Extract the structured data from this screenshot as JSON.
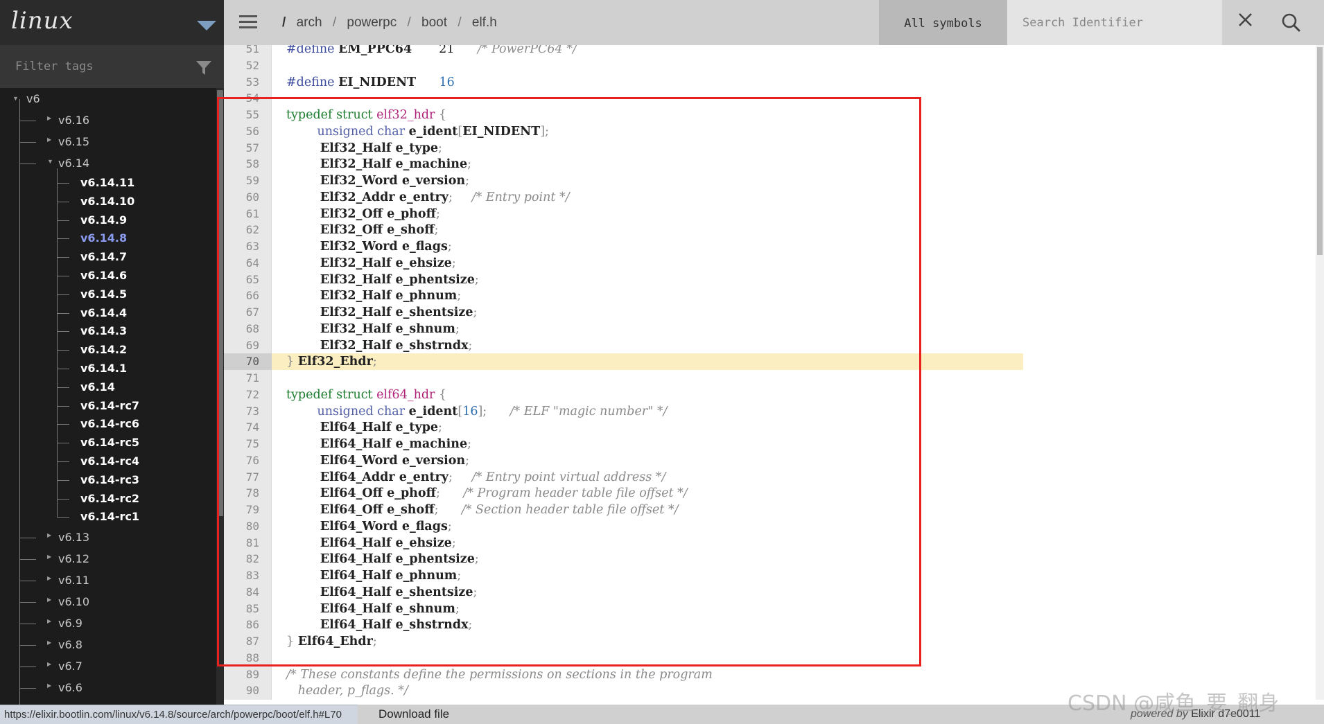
{
  "sidebar": {
    "project": "linux",
    "filter_placeholder": "Filter tags",
    "tree": [
      {
        "label": "v6",
        "kind": "root"
      },
      {
        "label": "v6.16",
        "kind": "ver"
      },
      {
        "label": "v6.15",
        "kind": "ver"
      },
      {
        "label": "v6.14",
        "kind": "ver-open"
      },
      {
        "label": "v6.14.11",
        "kind": "rel"
      },
      {
        "label": "v6.14.10",
        "kind": "rel"
      },
      {
        "label": "v6.14.9",
        "kind": "rel"
      },
      {
        "label": "v6.14.8",
        "kind": "rel",
        "current": true
      },
      {
        "label": "v6.14.7",
        "kind": "rel"
      },
      {
        "label": "v6.14.6",
        "kind": "rel"
      },
      {
        "label": "v6.14.5",
        "kind": "rel"
      },
      {
        "label": "v6.14.4",
        "kind": "rel"
      },
      {
        "label": "v6.14.3",
        "kind": "rel"
      },
      {
        "label": "v6.14.2",
        "kind": "rel"
      },
      {
        "label": "v6.14.1",
        "kind": "rel"
      },
      {
        "label": "v6.14",
        "kind": "rel"
      },
      {
        "label": "v6.14-rc7",
        "kind": "rel"
      },
      {
        "label": "v6.14-rc6",
        "kind": "rel"
      },
      {
        "label": "v6.14-rc5",
        "kind": "rel"
      },
      {
        "label": "v6.14-rc4",
        "kind": "rel"
      },
      {
        "label": "v6.14-rc3",
        "kind": "rel"
      },
      {
        "label": "v6.14-rc2",
        "kind": "rel"
      },
      {
        "label": "v6.14-rc1",
        "kind": "rel"
      },
      {
        "label": "v6.13",
        "kind": "ver"
      },
      {
        "label": "v6.12",
        "kind": "ver"
      },
      {
        "label": "v6.11",
        "kind": "ver"
      },
      {
        "label": "v6.10",
        "kind": "ver"
      },
      {
        "label": "v6.9",
        "kind": "ver"
      },
      {
        "label": "v6.8",
        "kind": "ver"
      },
      {
        "label": "v6.7",
        "kind": "ver"
      },
      {
        "label": "v6.6",
        "kind": "ver"
      }
    ]
  },
  "topbar": {
    "breadcrumb": [
      "arch",
      "powerpc",
      "boot",
      "elf.h"
    ],
    "root_sep": "/",
    "sep": "/",
    "symbols_label": "All symbols",
    "search_placeholder": "Search Identifier"
  },
  "code": {
    "highlight_line": 70,
    "lines": [
      {
        "n": 51,
        "t": [
          [
            "#define ",
            "mc"
          ],
          [
            "EM_PPC64",
            "bl"
          ],
          [
            "       21      ",
            ""
          ],
          [
            "/* PowerPC64 */",
            "cm"
          ]
        ]
      },
      {
        "n": 52,
        "t": []
      },
      {
        "n": 53,
        "t": [
          [
            "#define ",
            "mc"
          ],
          [
            "EI_NIDENT",
            "bl"
          ],
          [
            "      ",
            ""
          ],
          [
            "16",
            "nm"
          ]
        ]
      },
      {
        "n": 54,
        "t": []
      },
      {
        "n": 55,
        "t": [
          [
            "typedef ",
            "kw"
          ],
          [
            "struct ",
            "kw"
          ],
          [
            "elf32_hdr",
            "fn"
          ],
          [
            " {",
            "pu"
          ]
        ]
      },
      {
        "n": 56,
        "t": [
          [
            "        unsigned char ",
            "ty"
          ],
          [
            "e_ident",
            "bl"
          ],
          [
            "[",
            "pu"
          ],
          [
            "EI_NIDENT",
            "bl"
          ],
          [
            "];",
            "pu"
          ]
        ]
      },
      {
        "n": 57,
        "t": [
          [
            "        Elf32_Half ",
            "bl"
          ],
          [
            "e_type",
            "bl"
          ],
          [
            ";",
            "pu"
          ]
        ]
      },
      {
        "n": 58,
        "t": [
          [
            "        Elf32_Half ",
            "bl"
          ],
          [
            "e_machine",
            "bl"
          ],
          [
            ";",
            "pu"
          ]
        ]
      },
      {
        "n": 59,
        "t": [
          [
            "        Elf32_Word ",
            "bl"
          ],
          [
            "e_version",
            "bl"
          ],
          [
            ";",
            "pu"
          ]
        ]
      },
      {
        "n": 60,
        "t": [
          [
            "        Elf32_Addr ",
            "bl"
          ],
          [
            "e_entry",
            "bl"
          ],
          [
            ";     ",
            "pu"
          ],
          [
            "/* Entry point */",
            "cm"
          ]
        ]
      },
      {
        "n": 61,
        "t": [
          [
            "        Elf32_Off ",
            "bl"
          ],
          [
            "e_phoff",
            "bl"
          ],
          [
            ";",
            "pu"
          ]
        ]
      },
      {
        "n": 62,
        "t": [
          [
            "        Elf32_Off ",
            "bl"
          ],
          [
            "e_shoff",
            "bl"
          ],
          [
            ";",
            "pu"
          ]
        ]
      },
      {
        "n": 63,
        "t": [
          [
            "        Elf32_Word ",
            "bl"
          ],
          [
            "e_flags",
            "bl"
          ],
          [
            ";",
            "pu"
          ]
        ]
      },
      {
        "n": 64,
        "t": [
          [
            "        Elf32_Half ",
            "bl"
          ],
          [
            "e_ehsize",
            "bl"
          ],
          [
            ";",
            "pu"
          ]
        ]
      },
      {
        "n": 65,
        "t": [
          [
            "        Elf32_Half ",
            "bl"
          ],
          [
            "e_phentsize",
            "bl"
          ],
          [
            ";",
            "pu"
          ]
        ]
      },
      {
        "n": 66,
        "t": [
          [
            "        Elf32_Half ",
            "bl"
          ],
          [
            "e_phnum",
            "bl"
          ],
          [
            ";",
            "pu"
          ]
        ]
      },
      {
        "n": 67,
        "t": [
          [
            "        Elf32_Half ",
            "bl"
          ],
          [
            "e_shentsize",
            "bl"
          ],
          [
            ";",
            "pu"
          ]
        ]
      },
      {
        "n": 68,
        "t": [
          [
            "        Elf32_Half ",
            "bl"
          ],
          [
            "e_shnum",
            "bl"
          ],
          [
            ";",
            "pu"
          ]
        ]
      },
      {
        "n": 69,
        "t": [
          [
            "        Elf32_Half ",
            "bl"
          ],
          [
            "e_shstrndx",
            "bl"
          ],
          [
            ";",
            "pu"
          ]
        ]
      },
      {
        "n": 70,
        "t": [
          [
            "} ",
            "pu"
          ],
          [
            "Elf32_Ehdr",
            "bl"
          ],
          [
            ";",
            "pu"
          ]
        ]
      },
      {
        "n": 71,
        "t": []
      },
      {
        "n": 72,
        "t": [
          [
            "typedef ",
            "kw"
          ],
          [
            "struct ",
            "kw"
          ],
          [
            "elf64_hdr",
            "fn"
          ],
          [
            " {",
            "pu"
          ]
        ]
      },
      {
        "n": 73,
        "t": [
          [
            "        unsigned char ",
            "ty"
          ],
          [
            "e_ident",
            "bl"
          ],
          [
            "[",
            "pu"
          ],
          [
            "16",
            "nm"
          ],
          [
            "];      ",
            "pu"
          ],
          [
            "/* ELF \"magic number\" */",
            "cm"
          ]
        ]
      },
      {
        "n": 74,
        "t": [
          [
            "        Elf64_Half ",
            "bl"
          ],
          [
            "e_type",
            "bl"
          ],
          [
            ";",
            "pu"
          ]
        ]
      },
      {
        "n": 75,
        "t": [
          [
            "        Elf64_Half ",
            "bl"
          ],
          [
            "e_machine",
            "bl"
          ],
          [
            ";",
            "pu"
          ]
        ]
      },
      {
        "n": 76,
        "t": [
          [
            "        Elf64_Word ",
            "bl"
          ],
          [
            "e_version",
            "bl"
          ],
          [
            ";",
            "pu"
          ]
        ]
      },
      {
        "n": 77,
        "t": [
          [
            "        Elf64_Addr ",
            "bl"
          ],
          [
            "e_entry",
            "bl"
          ],
          [
            ";     ",
            "pu"
          ],
          [
            "/* Entry point virtual address */",
            "cm"
          ]
        ]
      },
      {
        "n": 78,
        "t": [
          [
            "        Elf64_Off ",
            "bl"
          ],
          [
            "e_phoff",
            "bl"
          ],
          [
            ";      ",
            "pu"
          ],
          [
            "/* Program header table file offset */",
            "cm"
          ]
        ]
      },
      {
        "n": 79,
        "t": [
          [
            "        Elf64_Off ",
            "bl"
          ],
          [
            "e_shoff",
            "bl"
          ],
          [
            ";      ",
            "pu"
          ],
          [
            "/* Section header table file offset */",
            "cm"
          ]
        ]
      },
      {
        "n": 80,
        "t": [
          [
            "        Elf64_Word ",
            "bl"
          ],
          [
            "e_flags",
            "bl"
          ],
          [
            ";",
            "pu"
          ]
        ]
      },
      {
        "n": 81,
        "t": [
          [
            "        Elf64_Half ",
            "bl"
          ],
          [
            "e_ehsize",
            "bl"
          ],
          [
            ";",
            "pu"
          ]
        ]
      },
      {
        "n": 82,
        "t": [
          [
            "        Elf64_Half ",
            "bl"
          ],
          [
            "e_phentsize",
            "bl"
          ],
          [
            ";",
            "pu"
          ]
        ]
      },
      {
        "n": 83,
        "t": [
          [
            "        Elf64_Half ",
            "bl"
          ],
          [
            "e_phnum",
            "bl"
          ],
          [
            ";",
            "pu"
          ]
        ]
      },
      {
        "n": 84,
        "t": [
          [
            "        Elf64_Half ",
            "bl"
          ],
          [
            "e_shentsize",
            "bl"
          ],
          [
            ";",
            "pu"
          ]
        ]
      },
      {
        "n": 85,
        "t": [
          [
            "        Elf64_Half ",
            "bl"
          ],
          [
            "e_shnum",
            "bl"
          ],
          [
            ";",
            "pu"
          ]
        ]
      },
      {
        "n": 86,
        "t": [
          [
            "        Elf64_Half ",
            "bl"
          ],
          [
            "e_shstrndx",
            "bl"
          ],
          [
            ";",
            "pu"
          ]
        ]
      },
      {
        "n": 87,
        "t": [
          [
            "} ",
            "pu"
          ],
          [
            "Elf64_Ehdr",
            "bl"
          ],
          [
            ";",
            "pu"
          ]
        ]
      },
      {
        "n": 88,
        "t": []
      },
      {
        "n": 89,
        "t": [
          [
            "/* These constants define the permissions on sections in the program",
            "cm"
          ]
        ]
      },
      {
        "n": 90,
        "t": [
          [
            "   header, p_flags. */",
            "cm"
          ]
        ]
      }
    ]
  },
  "status": {
    "url": "https://elixir.bootlin.com/linux/v6.14.8/source/arch/powerpc/boot/elf.h#L70",
    "download": "Download file",
    "powered_prefix": "powered by",
    "powered_name": "Elixir d7e0011"
  },
  "watermark": "CSDN @咸鱼_要_翻身",
  "colors": {
    "annotation_box": "#e8211e",
    "current_tag": "#8a9bef",
    "line_highlight": "#fbeec1"
  }
}
